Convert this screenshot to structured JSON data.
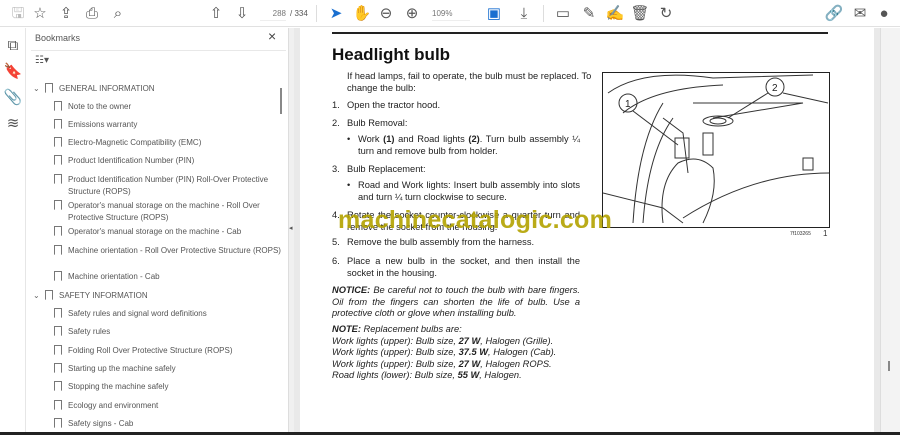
{
  "toolbar": {
    "page_current": "288",
    "page_total": "/ 334",
    "zoom": "109%"
  },
  "bookmarks": {
    "title": "Bookmarks",
    "items": [
      {
        "label": "GENERAL INFORMATION",
        "level": 0
      },
      {
        "label": "Note to the owner",
        "level": 1
      },
      {
        "label": "Emissions warranty",
        "level": 1
      },
      {
        "label": "Electro-Magnetic Compatibility (EMC)",
        "level": 1
      },
      {
        "label": "Product Identification Number (PIN)",
        "level": 1
      },
      {
        "label": "Product Identification Number (PIN) Roll-Over Protective Structure (ROPS)",
        "level": 1
      },
      {
        "label": "Operator's manual storage on the machine - Roll Over Protective Structure (ROPS)",
        "level": 1
      },
      {
        "label": "Operator's manual storage on the machine - Cab",
        "level": 1
      },
      {
        "label": "Machine orientation - Roll Over Protective Structure (ROPS)",
        "level": 1
      },
      {
        "label": "Machine orientation - Cab",
        "level": 1
      },
      {
        "label": "SAFETY INFORMATION",
        "level": 0
      },
      {
        "label": "Safety rules and signal word definitions",
        "level": 1
      },
      {
        "label": "Safety rules",
        "level": 1
      },
      {
        "label": "Folding Roll Over Protective Structure (ROPS)",
        "level": 1
      },
      {
        "label": "Starting up the machine safely",
        "level": 1
      },
      {
        "label": "Stopping the machine safely",
        "level": 1
      },
      {
        "label": "Ecology and environment",
        "level": 1
      },
      {
        "label": "Safety signs - Cab",
        "level": 1
      }
    ]
  },
  "doc": {
    "title": "Headlight bulb",
    "intro": "If head lamps, fail to operate, the bulb must be replaced. To change the bulb:",
    "steps": [
      {
        "n": "1.",
        "text": "Open the tractor hood."
      },
      {
        "n": "2.",
        "text": "Bulb Removal:"
      },
      {
        "n": "3.",
        "text": "Bulb Replacement:"
      },
      {
        "n": "4.",
        "text": "Rotate the socket counter-clockwise a quarter turn and remove the socket from the housing."
      },
      {
        "n": "5.",
        "text": "Remove the bulb assembly from the harness."
      },
      {
        "n": "6.",
        "text": "Place a new bulb in the socket, and then install the socket in the housing."
      }
    ],
    "sub2": {
      "a": "Work ",
      "b": "(1)",
      "c": " and Road lights ",
      "d": "(2)",
      "e": ". Turn bulb assembly ¼ turn and remove bulb from holder."
    },
    "sub3": "Road and Work lights: Insert bulb assembly into slots and turn ¼ turn clockwise to secure.",
    "notice_label": "NOTICE:",
    "notice": " Be careful not to touch the bulb with bare fingers. Oil from the fingers can shorten the life of bulb. Use a protective cloth or glove when installing bulb.",
    "note_label": "NOTE:",
    "note": " Replacement bulbs are:",
    "bulbs": [
      {
        "pre": "Work lights (upper): Bulb size, ",
        "w": "27 W",
        "post": ", Halogen (Grille)."
      },
      {
        "pre": "Work lights (upper): Bulb size, ",
        "w": "37.5 W",
        "post": ", Halogen (Cab)."
      },
      {
        "pre": "Work lights (upper): Bulb size, ",
        "w": "27 W",
        "post": ", Halogen ROPS."
      },
      {
        "pre": "Road lights (lower): Bulb size, ",
        "w": "55 W",
        "post": ", Halogen."
      }
    ],
    "figure": {
      "callout1": "1",
      "callout2": "2",
      "code": "7f103265",
      "number": "1"
    },
    "watermark": "machinecatalogic.com"
  }
}
